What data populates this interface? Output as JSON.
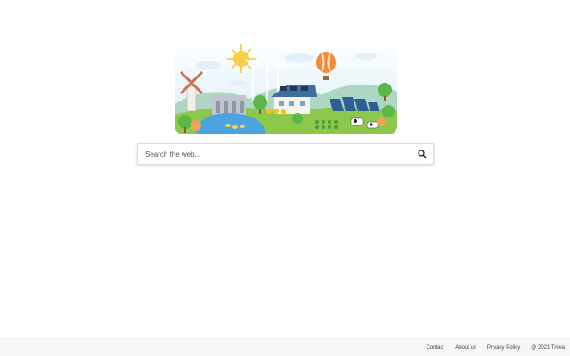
{
  "search": {
    "placeholder": "Search the web..."
  },
  "footer": {
    "links": [
      "Contact",
      "About us",
      "Privacy Policy"
    ],
    "copyright": "@ 2021 Trova"
  }
}
